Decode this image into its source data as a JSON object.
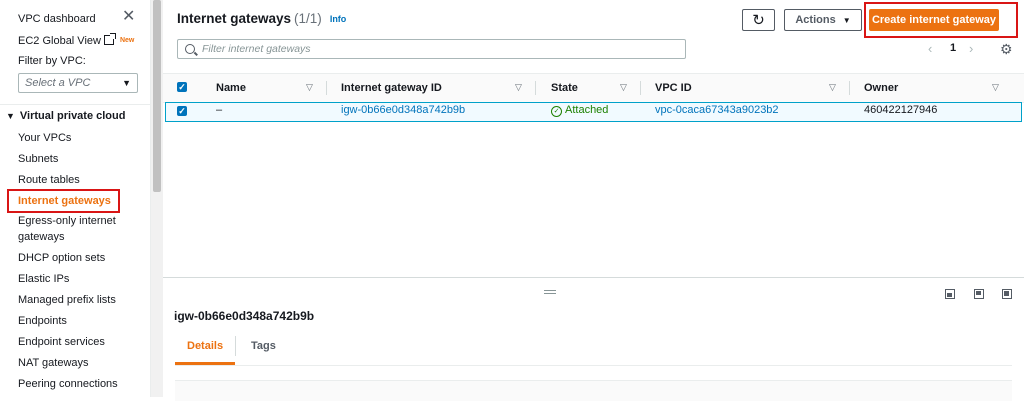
{
  "sidebar": {
    "vpc_dashboard": "VPC dashboard",
    "ec2_global_view": "EC2 Global View",
    "new_badge": "New",
    "filter_label": "Filter by VPC:",
    "vpc_select_placeholder": "Select a VPC",
    "section_title": "Virtual private cloud",
    "items": [
      {
        "label": "Your VPCs"
      },
      {
        "label": "Subnets"
      },
      {
        "label": "Route tables"
      },
      {
        "label": "Internet gateways"
      },
      {
        "label": "Egress-only internet gateways"
      },
      {
        "label": "DHCP option sets"
      },
      {
        "label": "Elastic IPs"
      },
      {
        "label": "Managed prefix lists"
      },
      {
        "label": "Endpoints"
      },
      {
        "label": "Endpoint services"
      },
      {
        "label": "NAT gateways"
      },
      {
        "label": "Peering connections"
      }
    ],
    "active_item": "Internet gateways"
  },
  "header": {
    "title": "Internet gateways",
    "count": "(1/1)",
    "info": "Info",
    "actions_label": "Actions",
    "create_label": "Create internet gateway",
    "search_placeholder": "Filter internet gateways",
    "page_number": "1"
  },
  "table": {
    "columns": [
      "Name",
      "Internet gateway ID",
      "State",
      "VPC ID",
      "Owner"
    ],
    "rows": [
      {
        "name": "–",
        "gateway_id": "igw-0b66e0d348a742b9b",
        "state": "Attached",
        "vpc_id": "vpc-0caca67343a9023b2",
        "owner": "460422127946"
      }
    ]
  },
  "detail_panel": {
    "title": "igw-0b66e0d348a742b9b",
    "tabs": [
      "Details",
      "Tags"
    ],
    "active_tab": "Details"
  },
  "colors": {
    "accent": "#ec7211",
    "link": "#0073bb",
    "success": "#1d8102",
    "highlight_box": "#d91515"
  },
  "icons": [
    "close-icon",
    "external-link-icon",
    "caret-down-icon",
    "refresh-icon",
    "search-icon",
    "chevron-left-icon",
    "chevron-right-icon",
    "gear-icon",
    "check-circle-icon",
    "panel-bottom-icon",
    "panel-side-icon",
    "panel-full-icon"
  ]
}
